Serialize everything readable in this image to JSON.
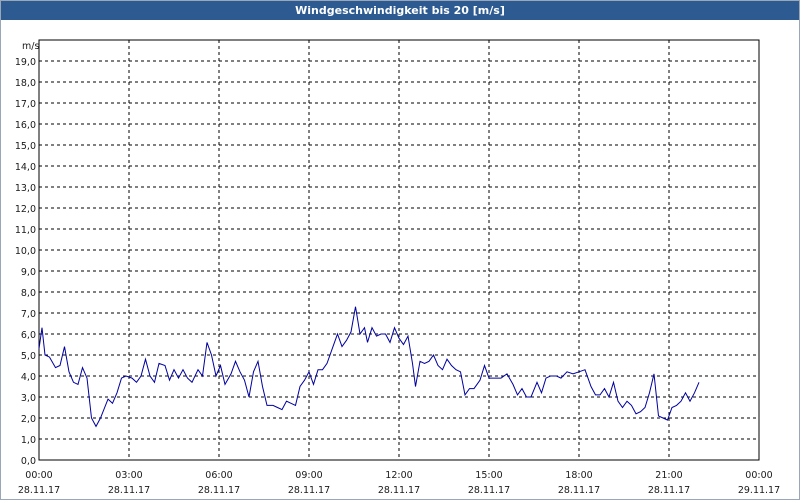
{
  "window": {
    "title": "Windgeschwindigkeit bis 20 [m/s]"
  },
  "chart_data": {
    "type": "line",
    "title": "Windgeschwindigkeit bis 20 [m/s]",
    "ylabel": "m/s",
    "ylim": [
      0,
      20
    ],
    "xlim_hours": [
      0,
      24
    ],
    "grid": true,
    "y_ticks": [
      "0,0",
      "1,0",
      "2,0",
      "3,0",
      "4,0",
      "5,0",
      "6,0",
      "7,0",
      "8,0",
      "9,0",
      "10,0",
      "11,0",
      "12,0",
      "13,0",
      "14,0",
      "15,0",
      "16,0",
      "17,0",
      "18,0",
      "19,0"
    ],
    "x_ticks": [
      {
        "time": "00:00",
        "date": "28.11.17"
      },
      {
        "time": "03:00",
        "date": "28.11.17"
      },
      {
        "time": "06:00",
        "date": "28.11.17"
      },
      {
        "time": "09:00",
        "date": "28.11.17"
      },
      {
        "time": "12:00",
        "date": "28.11.17"
      },
      {
        "time": "15:00",
        "date": "28.11.17"
      },
      {
        "time": "18:00",
        "date": "28.11.17"
      },
      {
        "time": "21:00",
        "date": "28.11.17"
      },
      {
        "time": "00:00",
        "date": "29.11.17"
      }
    ],
    "series": [
      {
        "color": "#0000a0",
        "points": [
          [
            0.0,
            5.3
          ],
          [
            0.1,
            6.3
          ],
          [
            0.2,
            5.0
          ],
          [
            0.35,
            4.9
          ],
          [
            0.55,
            4.4
          ],
          [
            0.7,
            4.5
          ],
          [
            0.85,
            5.4
          ],
          [
            1.0,
            4.2
          ],
          [
            1.15,
            3.7
          ],
          [
            1.3,
            3.6
          ],
          [
            1.45,
            4.4
          ],
          [
            1.6,
            3.9
          ],
          [
            1.75,
            2.0
          ],
          [
            1.9,
            1.6
          ],
          [
            2.05,
            2.0
          ],
          [
            2.3,
            2.9
          ],
          [
            2.45,
            2.7
          ],
          [
            2.6,
            3.2
          ],
          [
            2.75,
            3.9
          ],
          [
            2.9,
            4.0
          ],
          [
            3.1,
            3.9
          ],
          [
            3.25,
            3.7
          ],
          [
            3.4,
            4.0
          ],
          [
            3.55,
            4.8
          ],
          [
            3.7,
            4.0
          ],
          [
            3.85,
            3.7
          ],
          [
            4.0,
            4.6
          ],
          [
            4.2,
            4.5
          ],
          [
            4.35,
            3.8
          ],
          [
            4.5,
            4.3
          ],
          [
            4.65,
            3.9
          ],
          [
            4.8,
            4.3
          ],
          [
            4.95,
            3.9
          ],
          [
            5.1,
            3.7
          ],
          [
            5.3,
            4.3
          ],
          [
            5.45,
            4.0
          ],
          [
            5.6,
            5.6
          ],
          [
            5.75,
            5.0
          ],
          [
            5.9,
            4.0
          ],
          [
            6.05,
            4.5
          ],
          [
            6.2,
            3.6
          ],
          [
            6.4,
            4.1
          ],
          [
            6.55,
            4.7
          ],
          [
            6.7,
            4.2
          ],
          [
            6.85,
            3.8
          ],
          [
            7.0,
            3.0
          ],
          [
            7.15,
            4.2
          ],
          [
            7.3,
            4.7
          ],
          [
            7.45,
            3.5
          ],
          [
            7.6,
            2.6
          ],
          [
            7.8,
            2.6
          ],
          [
            7.95,
            2.5
          ],
          [
            8.1,
            2.4
          ],
          [
            8.25,
            2.8
          ],
          [
            8.4,
            2.7
          ],
          [
            8.55,
            2.6
          ],
          [
            8.7,
            3.5
          ],
          [
            8.85,
            3.8
          ],
          [
            9.0,
            4.2
          ],
          [
            9.15,
            3.6
          ],
          [
            9.3,
            4.3
          ],
          [
            9.45,
            4.3
          ],
          [
            9.6,
            4.6
          ],
          [
            9.8,
            5.4
          ],
          [
            9.95,
            6.0
          ],
          [
            10.1,
            5.4
          ],
          [
            10.25,
            5.7
          ],
          [
            10.4,
            6.1
          ],
          [
            10.55,
            7.3
          ],
          [
            10.7,
            6.0
          ],
          [
            10.85,
            6.3
          ],
          [
            10.95,
            5.6
          ],
          [
            11.1,
            6.3
          ],
          [
            11.25,
            5.9
          ],
          [
            11.4,
            6.0
          ],
          [
            11.55,
            6.0
          ],
          [
            11.7,
            5.6
          ],
          [
            11.85,
            6.3
          ],
          [
            12.0,
            5.8
          ],
          [
            12.15,
            5.5
          ],
          [
            12.3,
            5.9
          ],
          [
            12.45,
            4.6
          ],
          [
            12.55,
            3.5
          ],
          [
            12.7,
            4.7
          ],
          [
            12.85,
            4.6
          ],
          [
            13.0,
            4.7
          ],
          [
            13.15,
            5.0
          ],
          [
            13.3,
            4.5
          ],
          [
            13.45,
            4.3
          ],
          [
            13.6,
            4.8
          ],
          [
            13.75,
            4.5
          ],
          [
            13.9,
            4.3
          ],
          [
            14.05,
            4.2
          ],
          [
            14.2,
            3.1
          ],
          [
            14.35,
            3.4
          ],
          [
            14.5,
            3.4
          ],
          [
            14.7,
            3.8
          ],
          [
            14.85,
            4.5
          ],
          [
            15.0,
            3.9
          ],
          [
            15.2,
            3.9
          ],
          [
            15.4,
            3.9
          ],
          [
            15.6,
            4.1
          ],
          [
            15.8,
            3.6
          ],
          [
            15.95,
            3.1
          ],
          [
            16.1,
            3.4
          ],
          [
            16.25,
            3.0
          ],
          [
            16.4,
            3.0
          ],
          [
            16.6,
            3.7
          ],
          [
            16.75,
            3.2
          ],
          [
            16.9,
            3.9
          ],
          [
            17.05,
            4.0
          ],
          [
            17.25,
            4.0
          ],
          [
            17.4,
            3.9
          ],
          [
            17.6,
            4.2
          ],
          [
            17.8,
            4.1
          ],
          [
            18.0,
            4.2
          ],
          [
            18.2,
            4.3
          ],
          [
            18.4,
            3.5
          ],
          [
            18.55,
            3.1
          ],
          [
            18.7,
            3.1
          ],
          [
            18.85,
            3.4
          ],
          [
            19.0,
            3.0
          ],
          [
            19.15,
            3.7
          ],
          [
            19.3,
            2.8
          ],
          [
            19.45,
            2.5
          ],
          [
            19.6,
            2.8
          ],
          [
            19.75,
            2.6
          ],
          [
            19.9,
            2.2
          ],
          [
            20.05,
            2.3
          ],
          [
            20.2,
            2.5
          ],
          [
            20.35,
            3.2
          ],
          [
            20.5,
            4.1
          ],
          [
            20.65,
            2.1
          ],
          [
            20.8,
            2.0
          ],
          [
            20.95,
            1.9
          ],
          [
            21.1,
            2.5
          ],
          [
            21.25,
            2.6
          ],
          [
            21.4,
            2.8
          ],
          [
            21.55,
            3.2
          ],
          [
            21.7,
            2.8
          ],
          [
            21.85,
            3.2
          ],
          [
            22.0,
            3.7
          ]
        ]
      }
    ]
  }
}
